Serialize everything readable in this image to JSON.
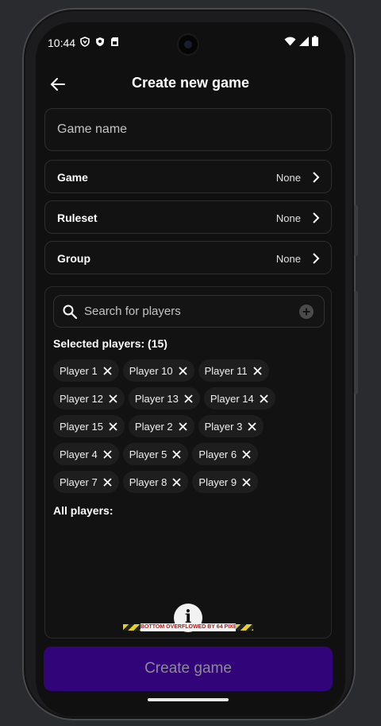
{
  "status_bar": {
    "time": "10:44",
    "left_icons": [
      "vpn-icon",
      "shield-icon",
      "sim-icon"
    ],
    "right_icons": [
      "wifi-icon",
      "signal-icon",
      "battery-icon"
    ]
  },
  "app_bar": {
    "title": "Create new game",
    "back_icon": "arrow-back-icon"
  },
  "form": {
    "game_name_placeholder": "Game name",
    "rows": [
      {
        "label": "Game",
        "value": "None"
      },
      {
        "label": "Ruleset",
        "value": "None"
      },
      {
        "label": "Group",
        "value": "None"
      }
    ]
  },
  "players": {
    "search_placeholder": "Search for players",
    "selected_title": "Selected players: (15)",
    "selected": [
      [
        "Player 1",
        "Player 10",
        "Player 11"
      ],
      [
        "Player 12",
        "Player 13",
        "Player 14"
      ],
      [
        "Player 15",
        "Player 2",
        "Player 3"
      ],
      [
        "Player 4",
        "Player 5",
        "Player 6"
      ],
      [
        "Player 7",
        "Player 8",
        "Player 9"
      ]
    ],
    "all_title": "All players:"
  },
  "overflow_warning": "BOTTOM OVERFLOWED BY 64 PIXELS",
  "create_button": "Create game",
  "colors": {
    "background": "#101010",
    "surface": "#121212",
    "chip": "#1e1e1e",
    "primary_button": "#320479",
    "button_text": "#8d8a98",
    "overflow_stripe": "#e5d11f",
    "overflow_text": "#c21818"
  }
}
